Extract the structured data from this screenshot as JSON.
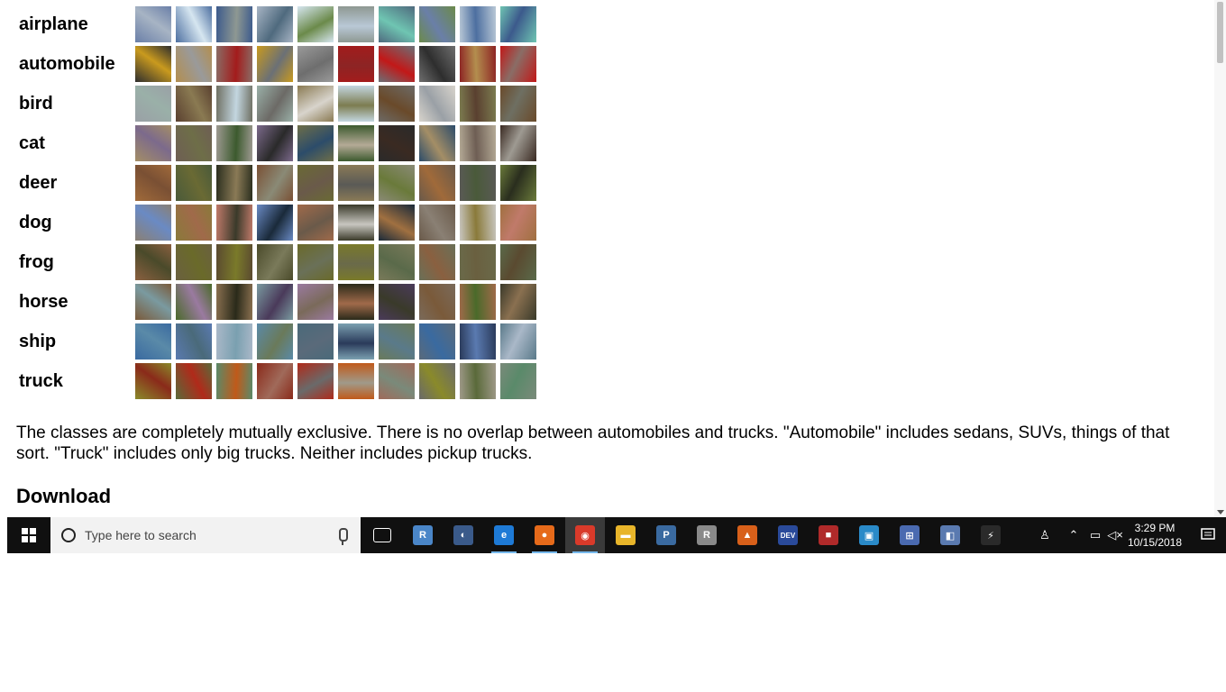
{
  "page": {
    "classes": [
      {
        "label": "airplane",
        "colors": [
          "#6a7fa8",
          "#4d6fa0",
          "#3c5a8c",
          "#a7b4c4",
          "#d6e6f0",
          "#8e9892",
          "#4f6a7e",
          "#6b8a4a",
          "#b9c8d6",
          "#6fc5b2"
        ]
      },
      {
        "label": "automobile",
        "colors": [
          "#2e2e2e",
          "#b38e4e",
          "#8a6d66",
          "#c99a1e",
          "#9a9a9a",
          "#a31c1c",
          "#6b7076",
          "#6e6e6e",
          "#8d2424",
          "#c21818"
        ]
      },
      {
        "label": "bird",
        "colors": [
          "#9aa0a6",
          "#5a4030",
          "#6e6f62",
          "#9ab0a8",
          "#8a7a52",
          "#c3d6e0",
          "#6c6a66",
          "#d8d4cc",
          "#7c7c50",
          "#6a4a2a"
        ]
      },
      {
        "label": "cat",
        "colors": [
          "#a48e66",
          "#6e5e54",
          "#9e9a92",
          "#7c6a8c",
          "#6e6e48",
          "#3c5a2e",
          "#2a2a2a",
          "#2c4c6a",
          "#b4aa96",
          "#3a2a22"
        ]
      },
      {
        "label": "deer",
        "colors": [
          "#a06a3a",
          "#4a5a3a",
          "#2a2e1e",
          "#7a5034",
          "#6a6a34",
          "#8a7a56",
          "#8a8a76",
          "#6a5a4a",
          "#5a5a56",
          "#6a7a3a"
        ]
      },
      {
        "label": "dog",
        "colors": [
          "#8a8074",
          "#8a7a3a",
          "#c07a6a",
          "#6a8ac4",
          "#a06a4a",
          "#3a3a2a",
          "#1a2a3a",
          "#6a5a4a",
          "#c8c6c0",
          "#a07040"
        ]
      },
      {
        "label": "frog",
        "colors": [
          "#8a6040",
          "#6a6040",
          "#5a4a30",
          "#4a4a2a",
          "#6a6a2a",
          "#7a7a2a",
          "#7a7a5a",
          "#6a7058",
          "#6a6a4a",
          "#5a6a4a"
        ]
      },
      {
        "label": "horse",
        "colors": [
          "#7a5a3a",
          "#4a6a2a",
          "#8a7050",
          "#7a9aa0",
          "#9a7aa0",
          "#2a2a1a",
          "#4a3a5a",
          "#7a6a5a",
          "#a06a4a",
          "#3a3a2a"
        ]
      },
      {
        "label": "ship",
        "colors": [
          "#3a6aa0",
          "#5a7ab0",
          "#aab8c8",
          "#5a8aa8",
          "#4a6a7a",
          "#7aa0b0",
          "#6a7a5a",
          "#5a6a7a",
          "#2a3a5a",
          "#5a7a8a"
        ]
      },
      {
        "label": "truck",
        "colors": [
          "#8a8a2a",
          "#5a6a3a",
          "#5a8a6a",
          "#8a2a1a",
          "#b02a1a",
          "#c05a1a",
          "#a06a5a",
          "#6a6a6a",
          "#a09a8a",
          "#7a8a7a"
        ]
      }
    ],
    "paragraph": "The classes are completely mutually exclusive. There is no overlap between automobiles and trucks. \"Automobile\" includes sedans, SUVs, things of that sort. \"Truck\" includes only big trucks. Neither includes pickup trucks.",
    "download_heading": "Download"
  },
  "taskbar": {
    "search_placeholder": "Type here to search",
    "apps": [
      {
        "name": "task-view-icon",
        "glyph": "▭",
        "color": "#101010"
      },
      {
        "name": "rstudio-icon",
        "glyph": "R",
        "color": "#4a86c8"
      },
      {
        "name": "photo-app-icon",
        "glyph": "◐",
        "color": "#3a5a8a"
      },
      {
        "name": "edge-icon",
        "glyph": "e",
        "color": "#1e7ad6"
      },
      {
        "name": "firefox-icon",
        "glyph": "●",
        "color": "#e66a1a"
      },
      {
        "name": "chrome-icon",
        "glyph": "◉",
        "color": "#d93a2a"
      },
      {
        "name": "file-explorer-icon",
        "glyph": "▬",
        "color": "#e8b52a"
      },
      {
        "name": "python-icon",
        "glyph": "P",
        "color": "#3a6aa0"
      },
      {
        "name": "r-icon",
        "glyph": "R",
        "color": "#8a8a8a"
      },
      {
        "name": "matlab-icon",
        "glyph": "▲",
        "color": "#d8601a"
      },
      {
        "name": "devcpp-icon",
        "glyph": "DEV",
        "color": "#2a4a9a"
      },
      {
        "name": "media-app-icon",
        "glyph": "■",
        "color": "#b02a2a"
      },
      {
        "name": "network-app-icon",
        "glyph": "▣",
        "color": "#2a8ac8"
      },
      {
        "name": "remote-desktop-icon",
        "glyph": "⊞",
        "color": "#4a6ab0"
      },
      {
        "name": "connection-icon",
        "glyph": "◧",
        "color": "#5a7ab0"
      },
      {
        "name": "terminal-icon",
        "glyph": "⚡",
        "color": "#2a2a2a"
      }
    ],
    "clock_time": "3:29 PM",
    "clock_date": "10/15/2018"
  }
}
